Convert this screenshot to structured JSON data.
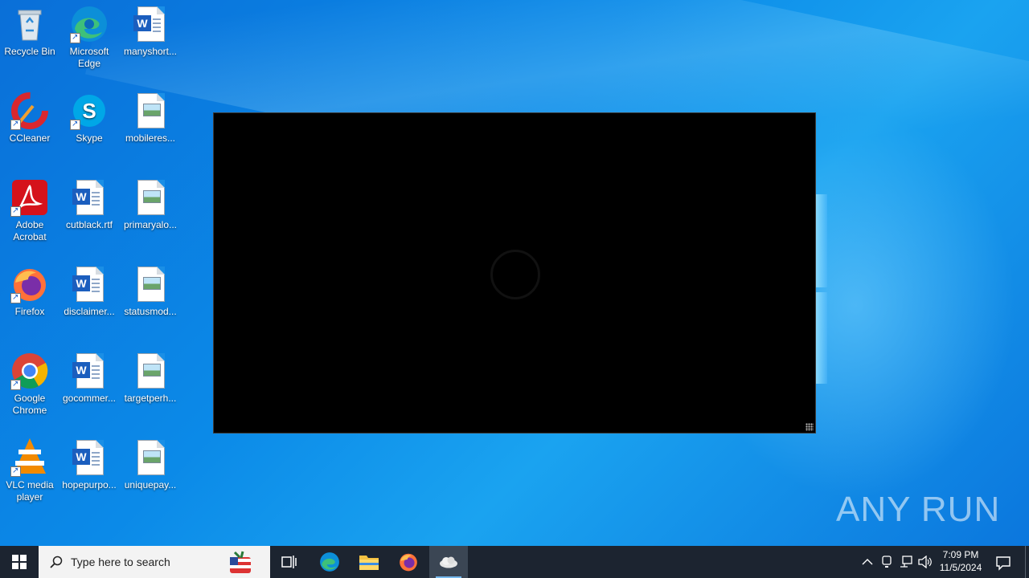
{
  "desktop": {
    "icons": [
      {
        "label": "Recycle Bin",
        "icon": "recycle-bin-icon"
      },
      {
        "label": "Microsoft Edge",
        "icon": "edge-icon"
      },
      {
        "label": "manyshort...",
        "icon": "word-doc-icon"
      },
      {
        "label": "CCleaner",
        "icon": "ccleaner-icon"
      },
      {
        "label": "Skype",
        "icon": "skype-icon"
      },
      {
        "label": "mobileres...",
        "icon": "image-file-icon"
      },
      {
        "label": "Adobe Acrobat",
        "icon": "acrobat-icon"
      },
      {
        "label": "cutblack.rtf",
        "icon": "word-doc-icon"
      },
      {
        "label": "primaryalo...",
        "icon": "image-file-icon"
      },
      {
        "label": "Firefox",
        "icon": "firefox-icon"
      },
      {
        "label": "disclaimer...",
        "icon": "word-doc-icon"
      },
      {
        "label": "statusmod...",
        "icon": "image-file-icon"
      },
      {
        "label": "Google Chrome",
        "icon": "chrome-icon"
      },
      {
        "label": "gocommer...",
        "icon": "word-doc-icon"
      },
      {
        "label": "targetperh...",
        "icon": "image-file-icon"
      },
      {
        "label": "VLC media player",
        "icon": "vlc-icon"
      },
      {
        "label": "hopepurpo...",
        "icon": "word-doc-icon"
      },
      {
        "label": "uniquepay...",
        "icon": "image-file-icon"
      }
    ],
    "watermark": "ANY RUN"
  },
  "taskbar": {
    "search_placeholder": "Type here to search",
    "apps": [
      "edge-icon",
      "file-explorer-icon",
      "firefox-icon",
      "cloud-app-icon"
    ],
    "clock_time": "7:09 PM",
    "clock_date": "11/5/2024"
  },
  "colors": {
    "desktop_blue": "#0b8ae8",
    "taskbar": "#1c2430",
    "accent": "#76b9ed"
  }
}
